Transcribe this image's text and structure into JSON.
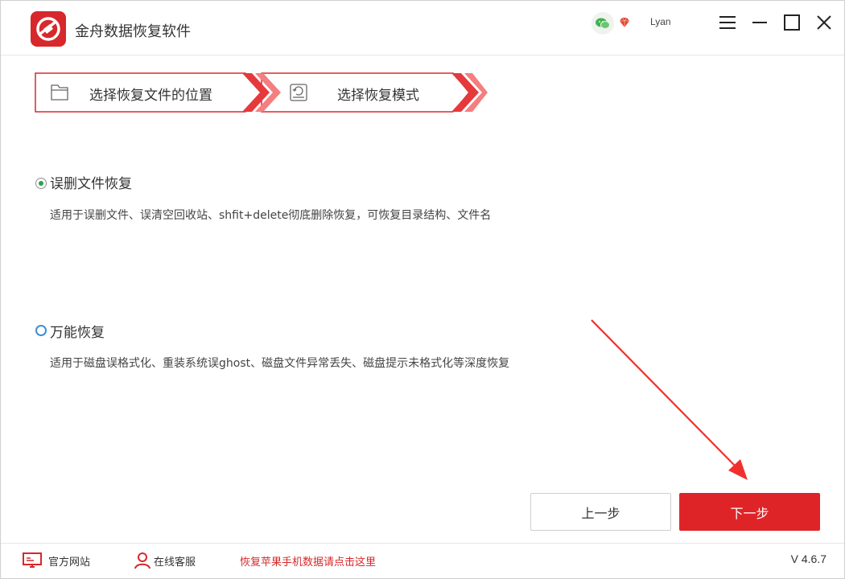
{
  "app": {
    "title": "金舟数据恢复软件",
    "username": "Lyan",
    "accent_color": "#df2428"
  },
  "window_controls": {
    "menu_icon": "hamburger-icon",
    "minimize_icon": "minimize-icon",
    "maximize_icon": "maximize-icon",
    "close_icon": "close-icon"
  },
  "steps": [
    {
      "label": "选择恢复文件的位置",
      "icon": "folder-icon",
      "active": false
    },
    {
      "label": "选择恢复模式",
      "icon": "disk-restore-icon",
      "active": true
    }
  ],
  "options": [
    {
      "title": "误删文件恢复",
      "description": "适用于误删文件、误清空回收站、shfit+delete彻底删除恢复，可恢复目录结构、文件名",
      "selected": true
    },
    {
      "title": "万能恢复",
      "description": "适用于磁盘误格式化、重装系统误ghost、磁盘文件异常丢失、磁盘提示未格式化等深度恢复",
      "selected": false
    }
  ],
  "buttons": {
    "prev_label": "上一步",
    "next_label": "下一步"
  },
  "footer": {
    "website_label": "官方网站",
    "support_label": "在线客服",
    "apple_link": "恢复苹果手机数据请点击这里",
    "version": "V 4.6.7"
  }
}
